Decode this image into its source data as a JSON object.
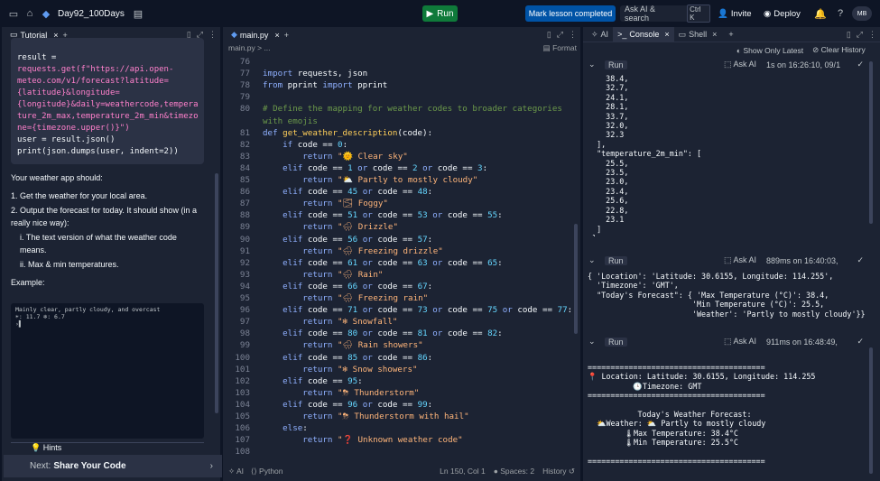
{
  "topbar": {
    "repl_name": "Day92_100Days",
    "run_label": "Run",
    "mark_complete_label": "Mark lesson completed",
    "ask_ai_label": "Ask AI & search",
    "ask_ai_shortcut": "Ctrl K",
    "invite_label": "Invite",
    "deploy_label": "Deploy",
    "avatar_initials": "MB"
  },
  "left_pane": {
    "tab_label": "Tutorial",
    "code_lines": [
      "result =",
      "requests.get(f\"https://api.open-",
      "meteo.com/v1/forecast?latitude=",
      "{latitude}&longitude=",
      "{longitude}&daily=weathercode,tempera",
      "ture_2m_max,temperature_2m_min&timezo",
      "ne={timezone.upper()}\")",
      "",
      "user = result.json()",
      "print(json.dumps(user, indent=2))"
    ],
    "intro": "Your weather app should:",
    "item1": "1. Get the weather for your local area.",
    "item2": "2. Output the forecast for today. It should show (in a really nice way):",
    "sub1": "i. The text version of what the weather code means.",
    "sub2": "ii. Max & min temperatures.",
    "example_label": "Example:",
    "example_line1": "Mainly clear, partly cloudy, and overcast",
    "example_line2": "☀: 11.7    ❄: 6.7",
    "hints_label": "Hints",
    "next_prefix": "Next:",
    "next_title": "Share Your Code"
  },
  "editor": {
    "tab_label": "main.py",
    "breadcrumb": "main.py > ...",
    "format_label": "Format",
    "status_ai": "AI",
    "status_lang": "Python",
    "status_pos": "Ln 150, Col 1",
    "status_spaces": "Spaces: 2",
    "status_history": "History",
    "lines": [
      {
        "n": "76",
        "html": ""
      },
      {
        "n": "77",
        "html": "<span class='kw'>import</span> requests, json"
      },
      {
        "n": "78",
        "html": "<span class='kw'>from</span> pprint <span class='kw'>import</span> pprint"
      },
      {
        "n": "79",
        "html": ""
      },
      {
        "n": "80",
        "html": "<span class='cm'># Define the mapping for weather codes to broader categories</span>"
      },
      {
        "n": "",
        "html": "<span class='cm'>with emojis</span>"
      },
      {
        "n": "81",
        "html": "<span class='kw'>def</span> <span class='fn'>get_weather_description</span>(code):"
      },
      {
        "n": "82",
        "html": "  <span class='kw'>if</span> code == <span class='nm'>0</span>:"
      },
      {
        "n": "83",
        "html": "    <span class='kw'>return</span> <span class='st'>\"🌞 Clear sky\"</span>"
      },
      {
        "n": "84",
        "html": "  <span class='kw'>elif</span> code == <span class='nm'>1</span> <span class='kw'>or</span> code == <span class='nm'>2</span> <span class='kw'>or</span> code == <span class='nm'>3</span>:"
      },
      {
        "n": "85",
        "html": "    <span class='kw'>return</span> <span class='st'>\"⛅ Partly to mostly cloudy\"</span>"
      },
      {
        "n": "86",
        "html": "  <span class='kw'>elif</span> code == <span class='nm'>45</span> <span class='kw'>or</span> code == <span class='nm'>48</span>:"
      },
      {
        "n": "87",
        "html": "    <span class='kw'>return</span> <span class='st'>\"🌫 Foggy\"</span>"
      },
      {
        "n": "88",
        "html": "  <span class='kw'>elif</span> code == <span class='nm'>51</span> <span class='kw'>or</span> code == <span class='nm'>53</span> <span class='kw'>or</span> code == <span class='nm'>55</span>:"
      },
      {
        "n": "89",
        "html": "    <span class='kw'>return</span> <span class='st'>\"🌧 Drizzle\"</span>"
      },
      {
        "n": "90",
        "html": "  <span class='kw'>elif</span> code == <span class='nm'>56</span> <span class='kw'>or</span> code == <span class='nm'>57</span>:"
      },
      {
        "n": "91",
        "html": "    <span class='kw'>return</span> <span class='st'>\"🌧 Freezing drizzle\"</span>"
      },
      {
        "n": "92",
        "html": "  <span class='kw'>elif</span> code == <span class='nm'>61</span> <span class='kw'>or</span> code == <span class='nm'>63</span> <span class='kw'>or</span> code == <span class='nm'>65</span>:"
      },
      {
        "n": "93",
        "html": "    <span class='kw'>return</span> <span class='st'>\"🌧 Rain\"</span>"
      },
      {
        "n": "94",
        "html": "  <span class='kw'>elif</span> code == <span class='nm'>66</span> <span class='kw'>or</span> code == <span class='nm'>67</span>:"
      },
      {
        "n": "95",
        "html": "    <span class='kw'>return</span> <span class='st'>\"🌧 Freezing rain\"</span>"
      },
      {
        "n": "96",
        "html": "  <span class='kw'>elif</span> code == <span class='nm'>71</span> <span class='kw'>or</span> code == <span class='nm'>73</span> <span class='kw'>or</span> code == <span class='nm'>75</span> <span class='kw'>or</span> code == <span class='nm'>77</span>:"
      },
      {
        "n": "97",
        "html": "    <span class='kw'>return</span> <span class='st'>\"❄ Snowfall\"</span>"
      },
      {
        "n": "98",
        "html": "  <span class='kw'>elif</span> code == <span class='nm'>80</span> <span class='kw'>or</span> code == <span class='nm'>81</span> <span class='kw'>or</span> code == <span class='nm'>82</span>:"
      },
      {
        "n": "99",
        "html": "    <span class='kw'>return</span> <span class='st'>\"🌧 Rain showers\"</span>"
      },
      {
        "n": "100",
        "html": "  <span class='kw'>elif</span> code == <span class='nm'>85</span> <span class='kw'>or</span> code == <span class='nm'>86</span>:"
      },
      {
        "n": "101",
        "html": "    <span class='kw'>return</span> <span class='st'>\"❄ Snow showers\"</span>"
      },
      {
        "n": "102",
        "html": "  <span class='kw'>elif</span> code == <span class='nm'>95</span>:"
      },
      {
        "n": "103",
        "html": "    <span class='kw'>return</span> <span class='st'>\"⛈ Thunderstorm\"</span>"
      },
      {
        "n": "104",
        "html": "  <span class='kw'>elif</span> code == <span class='nm'>96</span> <span class='kw'>or</span> code == <span class='nm'>99</span>:"
      },
      {
        "n": "105",
        "html": "    <span class='kw'>return</span> <span class='st'>\"⛈ Thunderstorm with hail\"</span>"
      },
      {
        "n": "106",
        "html": "  <span class='kw'>else</span>:"
      },
      {
        "n": "107",
        "html": "    <span class='kw'>return</span> <span class='st'>\"❓ Unknown weather code\"</span>"
      },
      {
        "n": "108",
        "html": ""
      }
    ]
  },
  "console": {
    "tab_ai": "AI",
    "tab_console": "Console",
    "tab_shell": "Shell",
    "show_latest": "Show Only Latest",
    "clear_history": "Clear History",
    "run1": {
      "label": "Run",
      "ask": "Ask AI",
      "time": "1s on 16:26:10, 09/1"
    },
    "out1": "    38.4,\n    32.7,\n    24.1,\n    28.1,\n    33.7,\n    32.0,\n    32.3\n  ],\n  \"temperature_2m_min\": [\n    25.5,\n    23.5,\n    23.0,\n    23.4,\n    25.6,\n    22.8,\n    23.1\n  ]\n }\n}",
    "run2": {
      "label": "Run",
      "ask": "Ask AI",
      "time": "889ms on 16:40:03,"
    },
    "out2": "{ 'Location': 'Latitude: 30.6155, Longitude: 114.255',\n  'Timezone': 'GMT',\n  \"Today's Forecast\": { 'Max Temperature (°C)': 38.4,\n                       'Min Temperature (°C)': 25.5,\n                       'Weather': 'Partly to mostly cloudy'}}",
    "run3": {
      "label": "Run",
      "ask": "Ask AI",
      "time": "911ms on 16:48:49,"
    },
    "out3": "=======================================\n📍 Location: Latitude: 30.6155, Longitude: 114.255\n          🕒Timezone: GMT\n=======================================\n\n           Today's Weather Forecast:\n  ⛅Weather: ⛅ Partly to mostly cloudy\n        🌡Max Temperature: 38.4°C\n        🌡Min Temperature: 25.5°C\n\n======================================="
  }
}
